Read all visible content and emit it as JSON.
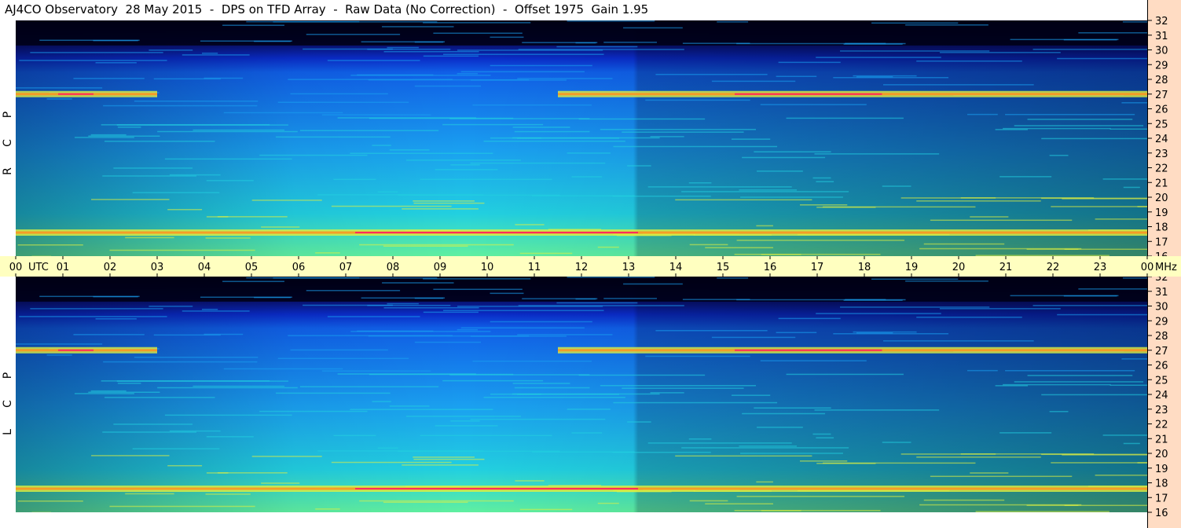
{
  "title": "AJ4CO Observatory  28 May 2015  -  DPS on TFD Array  -  Raw Data (No Correction)  -  Offset 1975  Gain 1.95",
  "panels": [
    {
      "polarization": [
        "P",
        "C",
        "R"
      ]
    },
    {
      "polarization": [
        "P",
        "C",
        "L"
      ]
    }
  ],
  "colors": {
    "axis_time_bg": "#ffffc0",
    "axis_freq_bg": "#ffdcc3",
    "colormap": [
      "#000014",
      "#08106a",
      "#0a2cc8",
      "#1060e8",
      "#1aa0f0",
      "#22d0e0",
      "#60f0a0",
      "#e0f040",
      "#ff9020",
      "#ff2060"
    ]
  },
  "chart_data": {
    "type": "heatmap",
    "x_unit_label": "UTC",
    "y_unit_label": "MHz",
    "x_ticks": [
      "00",
      "01",
      "02",
      "03",
      "04",
      "05",
      "06",
      "07",
      "08",
      "09",
      "10",
      "11",
      "12",
      "13",
      "14",
      "15",
      "16",
      "17",
      "18",
      "19",
      "20",
      "21",
      "22",
      "23",
      "00"
    ],
    "y_ticks": [
      "16",
      "17",
      "18",
      "19",
      "20",
      "21",
      "22",
      "23",
      "24",
      "25",
      "26",
      "27",
      "28",
      "29",
      "30",
      "31",
      "32"
    ],
    "xlim": [
      0,
      24
    ],
    "ylim": [
      16,
      32
    ],
    "features": [
      {
        "name": "strong interference band",
        "freq_mhz": 27.0,
        "active_utc": [
          [
            0,
            3
          ],
          [
            11.5,
            24
          ]
        ]
      },
      {
        "name": "strong interference band",
        "freq_mhz": 17.6,
        "active_utc": [
          [
            0,
            24
          ]
        ]
      },
      {
        "name": "broadband background",
        "peak_utc": 9.5,
        "low_freq_edge_mhz": 30.3
      }
    ]
  }
}
